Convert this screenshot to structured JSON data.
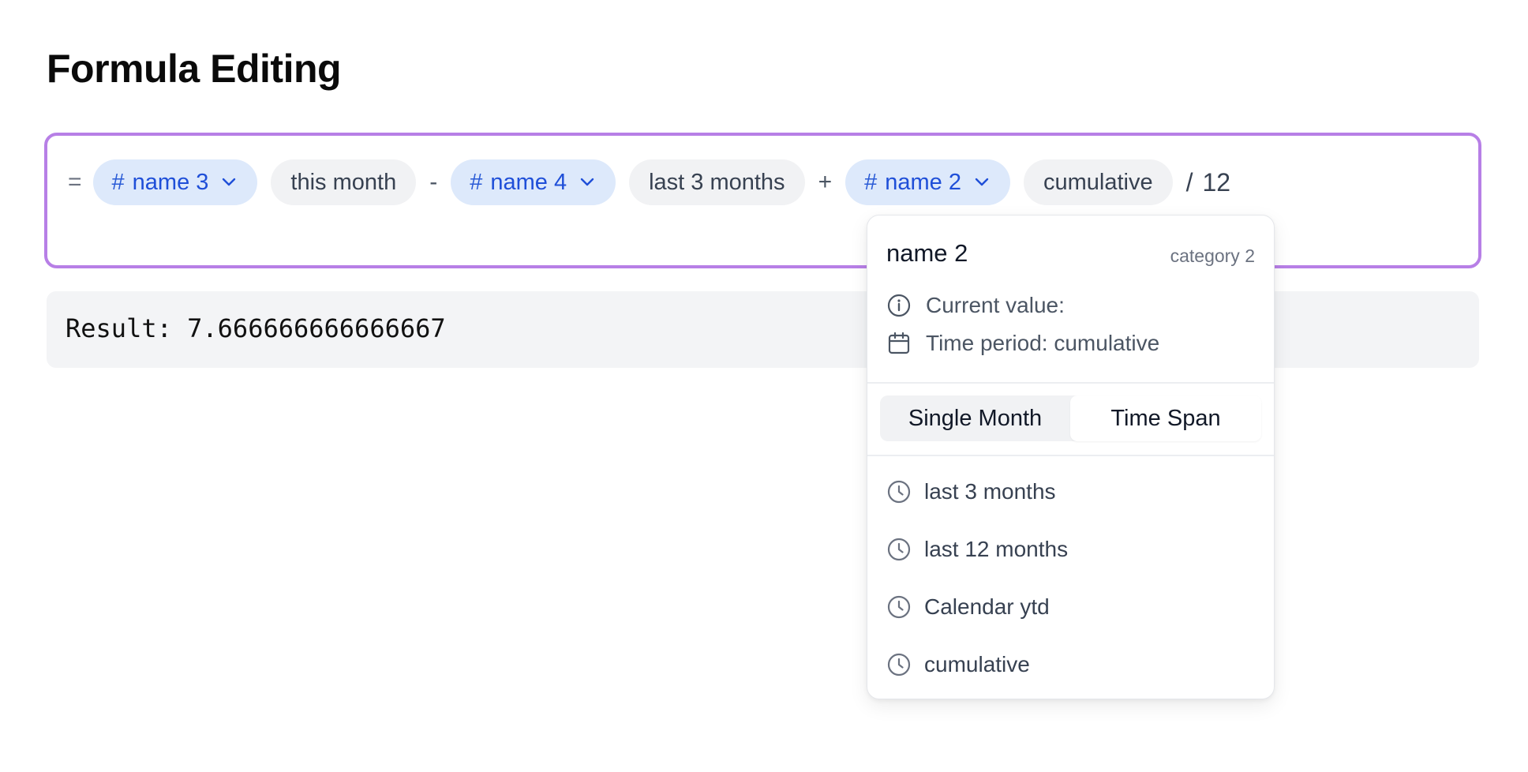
{
  "page": {
    "title": "Formula Editing"
  },
  "formula": {
    "equals": "=",
    "tokens": {
      "var1": {
        "hash": "#",
        "label": "name 3"
      },
      "time1": "this month",
      "op1": "-",
      "var2": {
        "hash": "#",
        "label": "name 4"
      },
      "time2": "last 3 months",
      "op2": "+",
      "var3": {
        "hash": "#",
        "label": "name 2"
      },
      "time3": "cumulative",
      "op3": "/",
      "number": "12"
    }
  },
  "result": {
    "text": "Result: 7.666666666666667"
  },
  "popover": {
    "name": "name 2",
    "category": "category 2",
    "current_value_label": "Current value:",
    "time_period_label": "Time period: cumulative",
    "mode_tabs": {
      "single": "Single Month",
      "span": "Time Span",
      "active": "Time Span"
    },
    "options": [
      "last 3 months",
      "last 12 months",
      "Calendar ytd",
      "cumulative"
    ]
  },
  "colors": {
    "editor_border": "#b77fe6",
    "chip_var_bg": "#dde9fb",
    "chip_var_text": "#1f4fd8",
    "chip_time_bg": "#f1f2f4",
    "result_bg": "#f3f4f6"
  },
  "icons": {
    "chip_chevron": "chevron-down-icon",
    "info": "info-icon",
    "calendar": "calendar-icon",
    "option": "clock-icon"
  }
}
